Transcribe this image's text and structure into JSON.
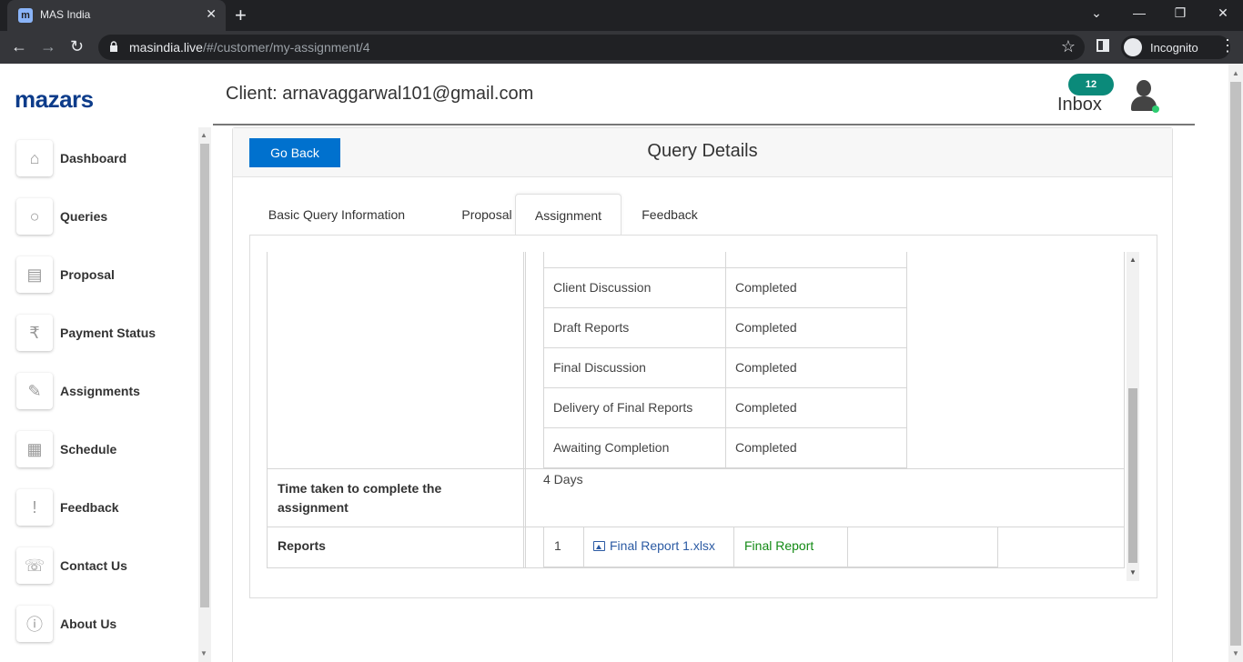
{
  "browser": {
    "tab_title": "MAS India",
    "favicon_letter": "m",
    "url_domain": "masindia.live",
    "url_path": "/#/customer/my-assignment/4",
    "incognito_label": "Incognito"
  },
  "app": {
    "logo": "mazars",
    "client_label": "Client: arnavaggarwal101@gmail.com",
    "inbox_label": "Inbox",
    "inbox_count": "12",
    "accent_color": "#0071ce",
    "badge_color": "#0b8a7a"
  },
  "sidebar": {
    "items": [
      {
        "label": "Dashboard",
        "icon": "home-icon"
      },
      {
        "label": "Queries",
        "icon": "search-icon"
      },
      {
        "label": "Proposal",
        "icon": "proposal-icon"
      },
      {
        "label": "Payment Status",
        "icon": "payment-icon"
      },
      {
        "label": "Assignments",
        "icon": "assignment-icon"
      },
      {
        "label": "Schedule",
        "icon": "calendar-icon"
      },
      {
        "label": "Feedback",
        "icon": "feedback-icon"
      },
      {
        "label": "Contact Us",
        "icon": "contact-icon"
      },
      {
        "label": "About Us",
        "icon": "info-icon"
      }
    ]
  },
  "card": {
    "go_back": "Go Back",
    "title": "Query Details",
    "tabs": [
      "Basic Query Information",
      "Proposal",
      "Assignment",
      "Feedback"
    ],
    "active_tab": "Assignment"
  },
  "assignment": {
    "steps": [
      {
        "name": "Client Discussion",
        "status": "Completed"
      },
      {
        "name": "Draft Reports",
        "status": "Completed"
      },
      {
        "name": "Final Discussion",
        "status": "Completed"
      },
      {
        "name": "Delivery of Final Reports",
        "status": "Completed"
      },
      {
        "name": "Awaiting Completion",
        "status": "Completed"
      }
    ],
    "time_taken_label": "Time taken to complete the assignment",
    "time_taken_value": "4 Days",
    "reports_label": "Reports",
    "reports": [
      {
        "index": "1",
        "file": "Final Report 1.xlsx",
        "type": "Final Report"
      }
    ]
  }
}
